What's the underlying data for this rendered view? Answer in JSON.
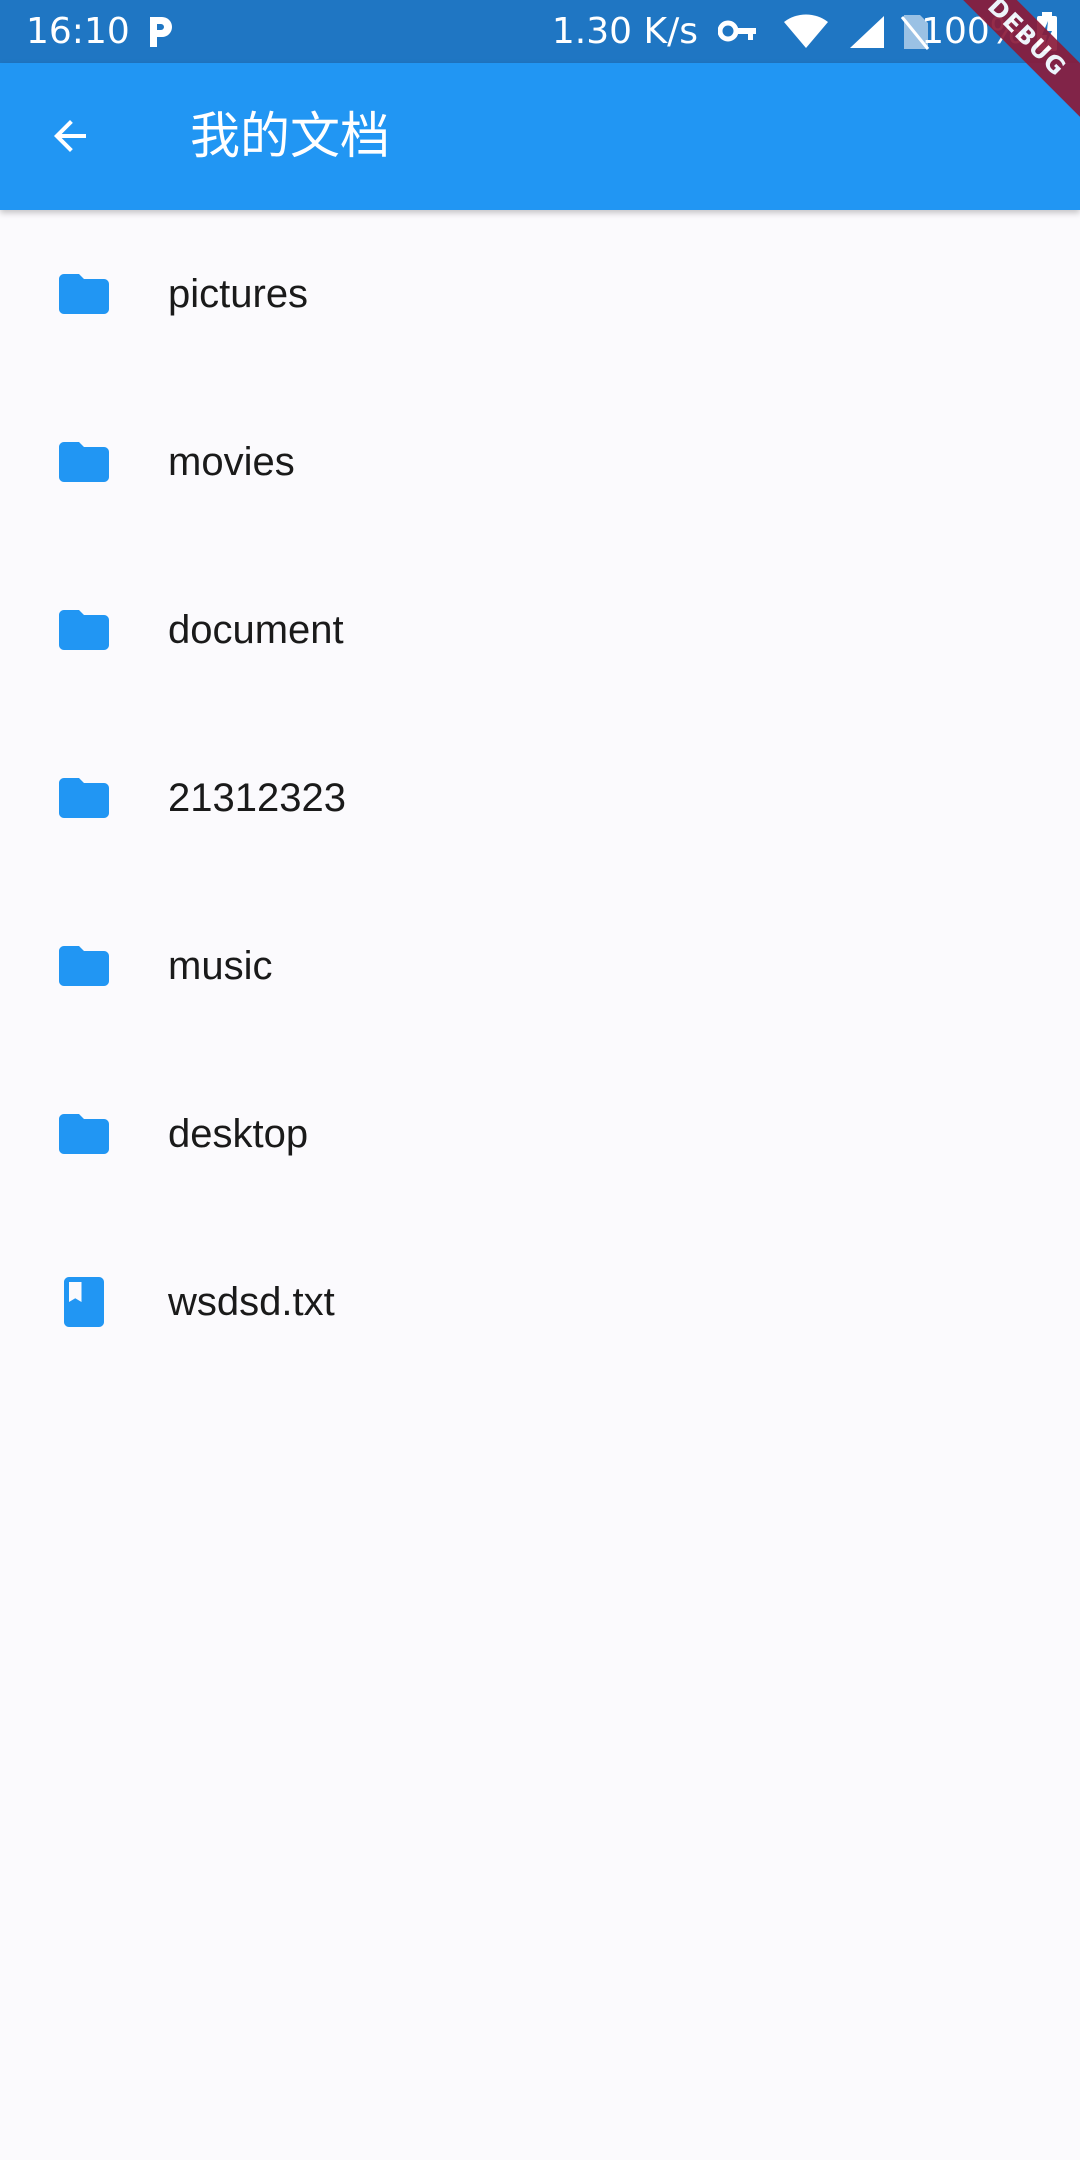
{
  "status_bar": {
    "time": "16:10",
    "app_icon": "p-icon",
    "net_speed": "1.30 K/s",
    "battery": "100%",
    "icons": [
      "key-icon",
      "wifi-icon",
      "signal-icon",
      "no-sim-icon",
      "battery-charging-icon"
    ]
  },
  "app_bar": {
    "back_icon": "arrow-back-icon",
    "title": "我的文档",
    "color": "#2196f3"
  },
  "debug_banner": "DEBUG",
  "files": [
    {
      "name": "pictures",
      "icon": "folder-icon"
    },
    {
      "name": "movies",
      "icon": "folder-icon"
    },
    {
      "name": "document",
      "icon": "folder-icon"
    },
    {
      "name": "21312323",
      "icon": "folder-icon"
    },
    {
      "name": "music",
      "icon": "folder-icon"
    },
    {
      "name": "desktop",
      "icon": "folder-icon"
    },
    {
      "name": "wsdsd.txt",
      "icon": "book-icon"
    }
  ]
}
